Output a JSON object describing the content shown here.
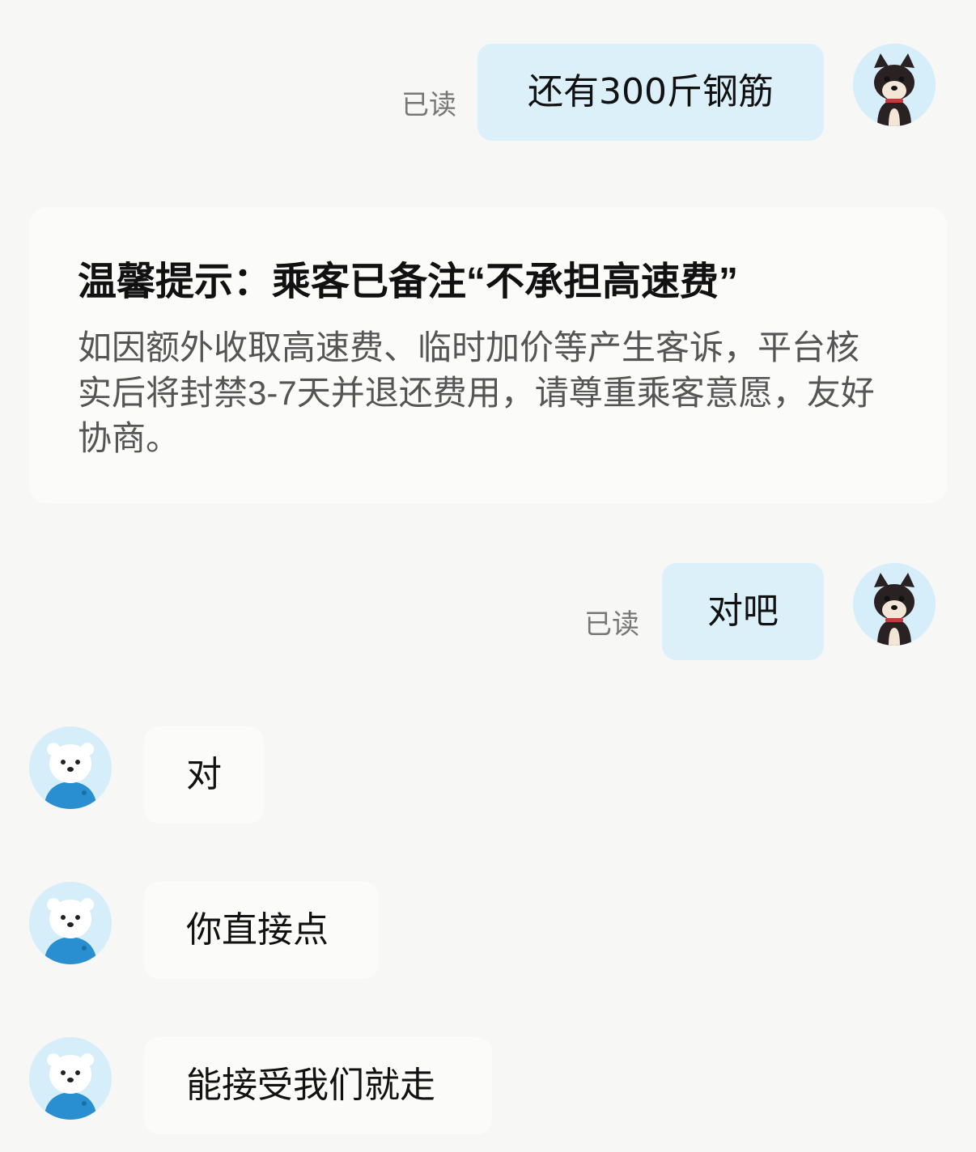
{
  "messages": [
    {
      "from": "me",
      "read_label": "已读",
      "text": "还有300斤钢筋",
      "avatar": "shiba-dog-avatar"
    },
    {
      "from": "me",
      "read_label": "已读",
      "text": "对吧",
      "avatar": "shiba-dog-avatar"
    },
    {
      "from": "other",
      "text": "对",
      "avatar": "polar-bear-avatar"
    },
    {
      "from": "other",
      "text": "你直接点",
      "avatar": "polar-bear-avatar"
    },
    {
      "from": "other",
      "text": "能接受我们就走",
      "avatar": "polar-bear-avatar"
    }
  ],
  "notice": {
    "title": "温馨提示：乘客已备注“不承担高速费”",
    "body": "如因额外收取高速费、临时加价等产生客诉，平台核实后将封禁3-7天并退还费用，请尊重乘客意愿，友好协商。"
  },
  "colors": {
    "background": "#f7f7f5",
    "outgoing_bubble": "#dcf0f9",
    "incoming_bubble": "#fbfbfa",
    "read_label": "#777777"
  }
}
